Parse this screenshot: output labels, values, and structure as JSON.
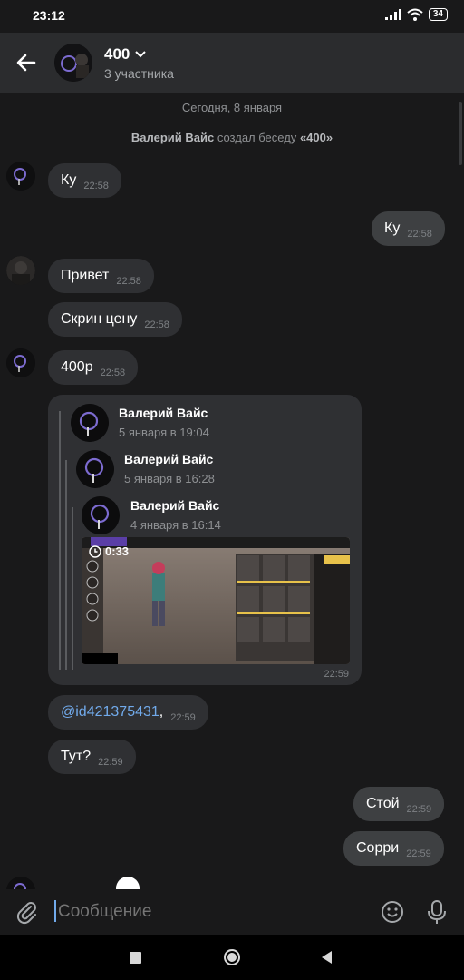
{
  "status_bar": {
    "time": "23:12",
    "battery": "34"
  },
  "header": {
    "title": "400",
    "subtitle": "3 участника"
  },
  "chat": {
    "date_divider": "Сегодня, 8 января",
    "service": {
      "actor": "Валерий Вайс",
      "action": "создал беседу",
      "name": "«400»"
    },
    "messages": [
      {
        "text": "Ку",
        "time": "22:58"
      },
      {
        "text": "Ку",
        "time": "22:58"
      },
      {
        "text": "Привет",
        "time": "22:58"
      },
      {
        "text": "Скрин цену",
        "time": "22:58"
      },
      {
        "text": "400р",
        "time": "22:58"
      },
      {
        "mention": "@id421375431",
        "suffix": ",",
        "time": "22:59"
      },
      {
        "text": "Тут?",
        "time": "22:59"
      },
      {
        "text": "Стой",
        "time": "22:59"
      },
      {
        "text": "Сорри",
        "time": "22:59"
      }
    ],
    "forward": {
      "time": "22:59",
      "levels": [
        {
          "name": "Валерий Вайс",
          "date": "5 января в 19:04"
        },
        {
          "name": "Валерий Вайс",
          "date": "5 января в 16:28"
        },
        {
          "name": "Валерий Вайс",
          "date": "4 января в 16:14"
        }
      ],
      "video_duration": "0:33"
    }
  },
  "input": {
    "placeholder": "Сообщение"
  },
  "colors": {
    "accent": "#71aaeb",
    "bubble_in": "#2f3033",
    "bubble_out": "#3e4042",
    "header_bg": "#2b2c2e"
  }
}
